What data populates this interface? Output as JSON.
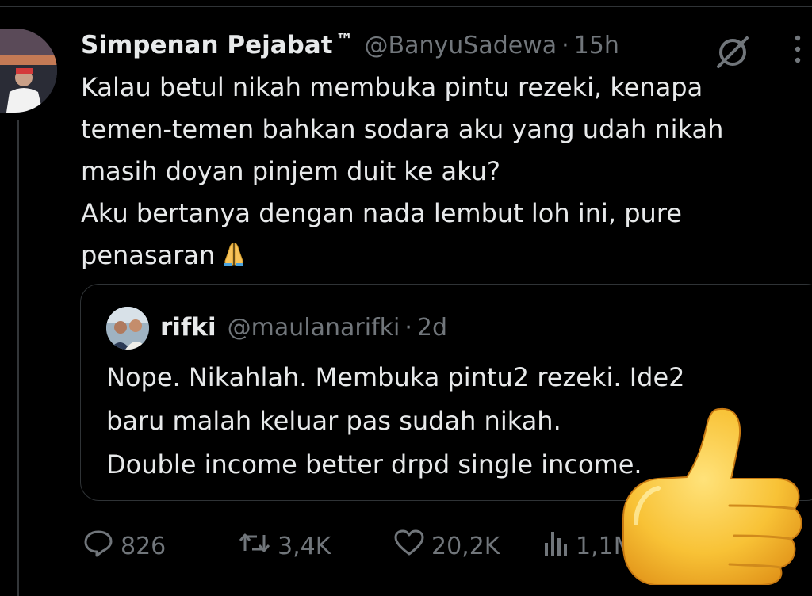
{
  "tweet": {
    "author_name": "Simpenan Pejabat",
    "trademark": "™",
    "handle": "@BanyuSadewa",
    "separator": "·",
    "time": "15h",
    "text": "Kalau betul nikah membuka pintu rezeki, kenapa\ntemen-temen bahkan sodara aku yang udah nikah\nmasih doyan pinjem duit ke aku?\nAku bertanya dengan nada lembut loh ini, pure\npenasaran",
    "emoji": "folded-hands"
  },
  "quoted": {
    "author_name": "rifki",
    "handle": "@maulanarifki",
    "separator": "·",
    "time": "2d",
    "text": "Nope. Nikahlah. Membuka pintu2 rezeki. Ide2\nbaru malah keluar pas sudah nikah.\nDouble income better drpd single income."
  },
  "actions": {
    "replies": "826",
    "reposts": "3,4K",
    "likes": "20,2K",
    "views": "1,1M"
  },
  "icons": [
    "grok-icon",
    "more-icon",
    "reply-icon",
    "repost-icon",
    "like-icon",
    "views-icon",
    "thumbs-up-sticker"
  ],
  "colors": {
    "background": "#000000",
    "text": "#e7e9ea",
    "secondary": "#71767b",
    "border": "#2f3336"
  }
}
